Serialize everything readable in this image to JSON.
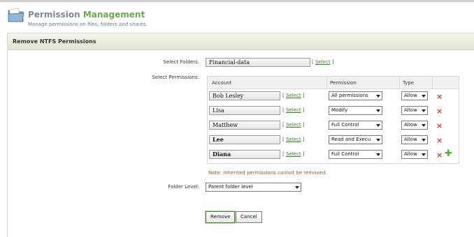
{
  "header": {
    "title_part1": "Permission ",
    "title_part2": "Management",
    "subtitle": "Manage permissions on files, folders and shares."
  },
  "panel": {
    "title": "Remove NTFS Permissions"
  },
  "form": {
    "select_folders_label": "Select Folders:",
    "folder_value": "Financial-data",
    "select_permissions_label": "Select Permissions:",
    "folder_level_label": "Folder Level:",
    "folder_level_value": "Parent folder level",
    "select_link": "Select",
    "bracket_open": "[ ",
    "bracket_close": " ]"
  },
  "table": {
    "headers": {
      "account": "Account",
      "permission": "Permission",
      "type": "Type"
    },
    "rows": [
      {
        "account": "Bob Lesley",
        "permission": "All permissions",
        "type": "Allow"
      },
      {
        "account": "Lisa",
        "permission": "Modify",
        "type": "Allow"
      },
      {
        "account": "Matthew",
        "permission": "Full Control",
        "type": "Allow"
      },
      {
        "account": "Lee",
        "permission": "Read and Execu",
        "type": "Allow"
      },
      {
        "account": "Diana",
        "permission": "Full Control",
        "type": "Allow"
      }
    ]
  },
  "note": "Note: Inherited permissions cannot be removed.",
  "buttons": {
    "remove": "Remove",
    "cancel": "Cancel"
  },
  "icons": {
    "delete": "×",
    "add": "✚"
  },
  "colors": {
    "accent_green": "#6aa84f",
    "link_green": "#3a7d2b",
    "delete_red": "#d23b2e"
  }
}
